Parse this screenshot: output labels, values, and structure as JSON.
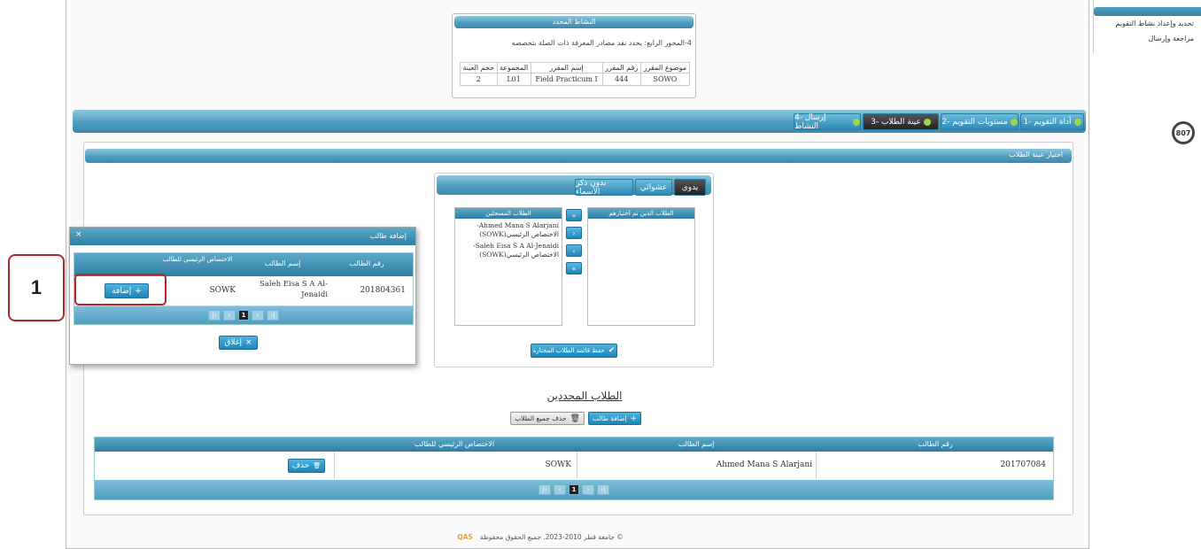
{
  "side_menu": {
    "items": [
      "تحديد وإعداد نشاط التقويم",
      "مراجعة وإرسال"
    ]
  },
  "badge": "807",
  "activity_box": {
    "title": "النشاط المحدد",
    "description": "4-المحور الرابع: يحدد نقد مصادر المعرفة ذات الصلة بتخصصه",
    "headers": [
      "موضوع المقرر",
      "رقم المقرر",
      "إسم المقرر",
      "المجموعة",
      "حجم العينة"
    ],
    "row": [
      "SOWO",
      "444",
      "Field Practicum I",
      "L01",
      "2"
    ]
  },
  "tabs": [
    "1- أداة التقويم",
    "2- مستويات التقويم",
    "3- عينة الطلاب",
    "4- إرسال النشاط"
  ],
  "section_title": "اختيار عينة الطلاب",
  "sample_tabs": [
    "يدوي",
    "عشوائي",
    "بدون ذكر الأسماء"
  ],
  "lists": {
    "left_title": "الطلاب المسجلين",
    "right_title": "الطلاب الذين تم اختيارهم",
    "students": [
      {
        "name": "-Ahmed Mana S Alarjani",
        "major": "الاختصاص الرئيسي(SOWK)"
      },
      {
        "name": "-Saleh Eisa S A Al-Jenaidi",
        "major": "الاختصاص الرئيسي(SOWK)"
      }
    ],
    "save_label": "حفظ قائمة الطلاب المختارة"
  },
  "dialog": {
    "title": "إضافة طالب",
    "headers": [
      "رقم الطالب",
      "إسم الطالب",
      "الاختصاص الرئيسي للطالب"
    ],
    "row": {
      "id": "201804361",
      "name": "Saleh Eisa S A Al-Jenaidi",
      "major": "SOWK",
      "action": "إضافة"
    },
    "page": "1",
    "close_label": "إغلاق"
  },
  "callout": "1",
  "selected": {
    "title": "الطلاب المحددين",
    "add_label": "إضافة طالب",
    "delete_all_label": "حذف جميع الطلاب",
    "headers": [
      "رقم الطالب",
      "إسم الطالب",
      "الاختصاص الرئيسي للطالب"
    ],
    "rows": [
      {
        "id": "201707084",
        "name": "Ahmed Mana S Alarjani",
        "major": "SOWK",
        "action": "حذف"
      }
    ],
    "page": "1"
  },
  "footer": "© جامعة قطر 2010-2023. جميع الحقوق محفوظة",
  "footer_logo": "QAS"
}
